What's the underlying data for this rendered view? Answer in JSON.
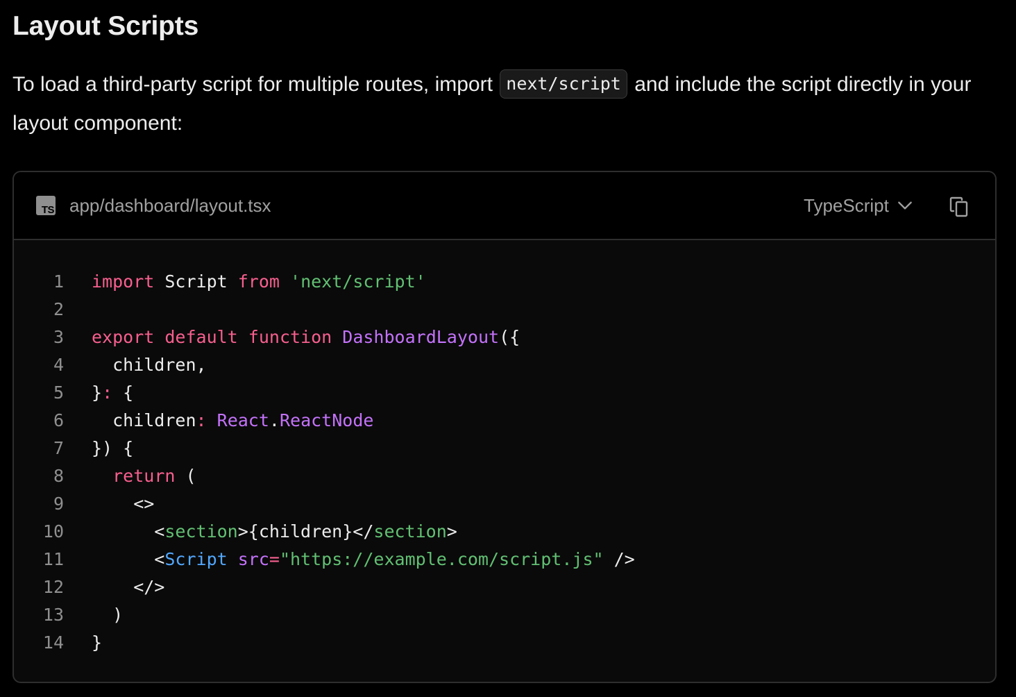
{
  "page": {
    "title": "Layout Scripts",
    "intro_before": "To load a third-party script for multiple routes, import ",
    "intro_code": "next/script",
    "intro_after": " and include the script directly in your layout component:"
  },
  "code_block": {
    "file_icon": "typescript-file-icon",
    "file_icon_text": "TS",
    "filename": "app/dashboard/layout.tsx",
    "language": "TypeScript",
    "language_icon": "chevron-down-icon",
    "copy_icon": "copy-icon",
    "colors": {
      "keyword": "#f75f8f",
      "string": "#62c073",
      "function": "#c472fb",
      "component": "#52a8ff",
      "plain": "#ededed",
      "line_number": "#8f8f8f"
    },
    "lines": [
      {
        "number": "1",
        "tokens": [
          {
            "t": "import",
            "k": "keyword"
          },
          {
            "t": " Script ",
            "k": "plain"
          },
          {
            "t": "from",
            "k": "keyword"
          },
          {
            "t": " ",
            "k": "plain"
          },
          {
            "t": "'next/script'",
            "k": "string"
          }
        ]
      },
      {
        "number": "2",
        "tokens": []
      },
      {
        "number": "3",
        "tokens": [
          {
            "t": "export",
            "k": "keyword"
          },
          {
            "t": " ",
            "k": "plain"
          },
          {
            "t": "default",
            "k": "keyword"
          },
          {
            "t": " ",
            "k": "plain"
          },
          {
            "t": "function",
            "k": "keyword"
          },
          {
            "t": " ",
            "k": "plain"
          },
          {
            "t": "DashboardLayout",
            "k": "func"
          },
          {
            "t": "({",
            "k": "plain"
          }
        ]
      },
      {
        "number": "4",
        "tokens": [
          {
            "t": "  children,",
            "k": "plain"
          }
        ]
      },
      {
        "number": "5",
        "tokens": [
          {
            "t": "}",
            "k": "plain"
          },
          {
            "t": ":",
            "k": "keyword"
          },
          {
            "t": " {",
            "k": "plain"
          }
        ]
      },
      {
        "number": "6",
        "tokens": [
          {
            "t": "  children",
            "k": "plain"
          },
          {
            "t": ":",
            "k": "keyword"
          },
          {
            "t": " ",
            "k": "plain"
          },
          {
            "t": "React",
            "k": "func"
          },
          {
            "t": ".",
            "k": "plain"
          },
          {
            "t": "ReactNode",
            "k": "func"
          }
        ]
      },
      {
        "number": "7",
        "tokens": [
          {
            "t": "}) {",
            "k": "plain"
          }
        ]
      },
      {
        "number": "8",
        "tokens": [
          {
            "t": "  ",
            "k": "plain"
          },
          {
            "t": "return",
            "k": "keyword"
          },
          {
            "t": " (",
            "k": "plain"
          }
        ]
      },
      {
        "number": "9",
        "tokens": [
          {
            "t": "    <>",
            "k": "plain"
          }
        ]
      },
      {
        "number": "10",
        "tokens": [
          {
            "t": "      <",
            "k": "plain"
          },
          {
            "t": "section",
            "k": "tag"
          },
          {
            "t": ">{children}</",
            "k": "plain"
          },
          {
            "t": "section",
            "k": "tag"
          },
          {
            "t": ">",
            "k": "plain"
          }
        ]
      },
      {
        "number": "11",
        "tokens": [
          {
            "t": "      <",
            "k": "plain"
          },
          {
            "t": "Script",
            "k": "comp"
          },
          {
            "t": " ",
            "k": "plain"
          },
          {
            "t": "src",
            "k": "attr"
          },
          {
            "t": "=",
            "k": "keyword"
          },
          {
            "t": "\"https://example.com/script.js\"",
            "k": "string"
          },
          {
            "t": " />",
            "k": "plain"
          }
        ]
      },
      {
        "number": "12",
        "tokens": [
          {
            "t": "    </>",
            "k": "plain"
          }
        ]
      },
      {
        "number": "13",
        "tokens": [
          {
            "t": "  )",
            "k": "plain"
          }
        ]
      },
      {
        "number": "14",
        "tokens": [
          {
            "t": "}",
            "k": "plain"
          }
        ]
      }
    ]
  }
}
